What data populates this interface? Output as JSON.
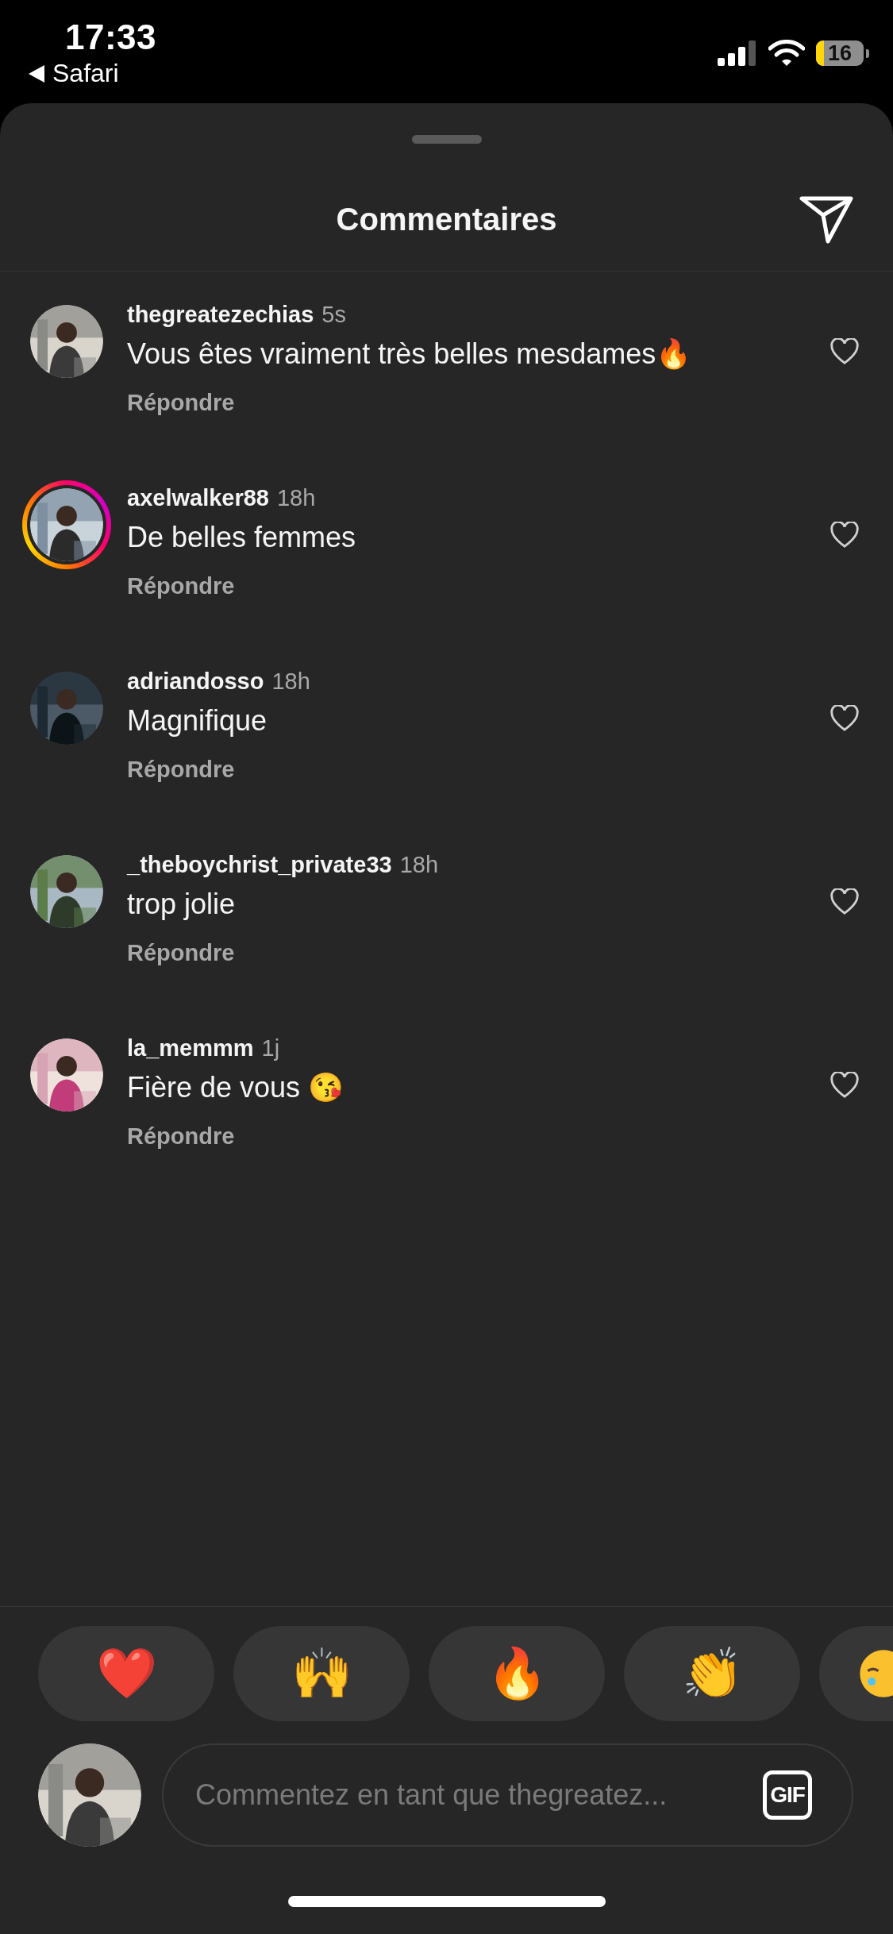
{
  "status_bar": {
    "time": "17:33",
    "back_app": "Safari",
    "battery": "16"
  },
  "sheet": {
    "title": "Commentaires"
  },
  "comments": [
    {
      "username": "thegreatezechias",
      "age": "5s",
      "text": "Vous êtes vraiment très belles mesdames🔥",
      "reply": "Répondre",
      "story_ring": false,
      "liked": false
    },
    {
      "username": "axelwalker88",
      "age": "18h",
      "text": "De belles femmes",
      "reply": "Répondre",
      "story_ring": true,
      "liked": false
    },
    {
      "username": "adriandosso",
      "age": "18h",
      "text": "Magnifique",
      "reply": "Répondre",
      "story_ring": false,
      "liked": false
    },
    {
      "username": "_theboychrist_private33",
      "age": "18h",
      "text": "trop jolie",
      "reply": "Répondre",
      "story_ring": false,
      "liked": false
    },
    {
      "username": "la_memmm",
      "age": "1j",
      "text": "Fière de vous 😘",
      "reply": "Répondre",
      "story_ring": false,
      "liked": false
    }
  ],
  "reactions": [
    {
      "emoji": "❤️"
    },
    {
      "emoji": "🙌"
    },
    {
      "emoji": "🔥"
    },
    {
      "emoji": "👏"
    },
    {
      "kind": "cut_off"
    }
  ],
  "composer": {
    "placeholder": "Commentez en tant que thegreatez...",
    "gif_label": "GIF"
  }
}
